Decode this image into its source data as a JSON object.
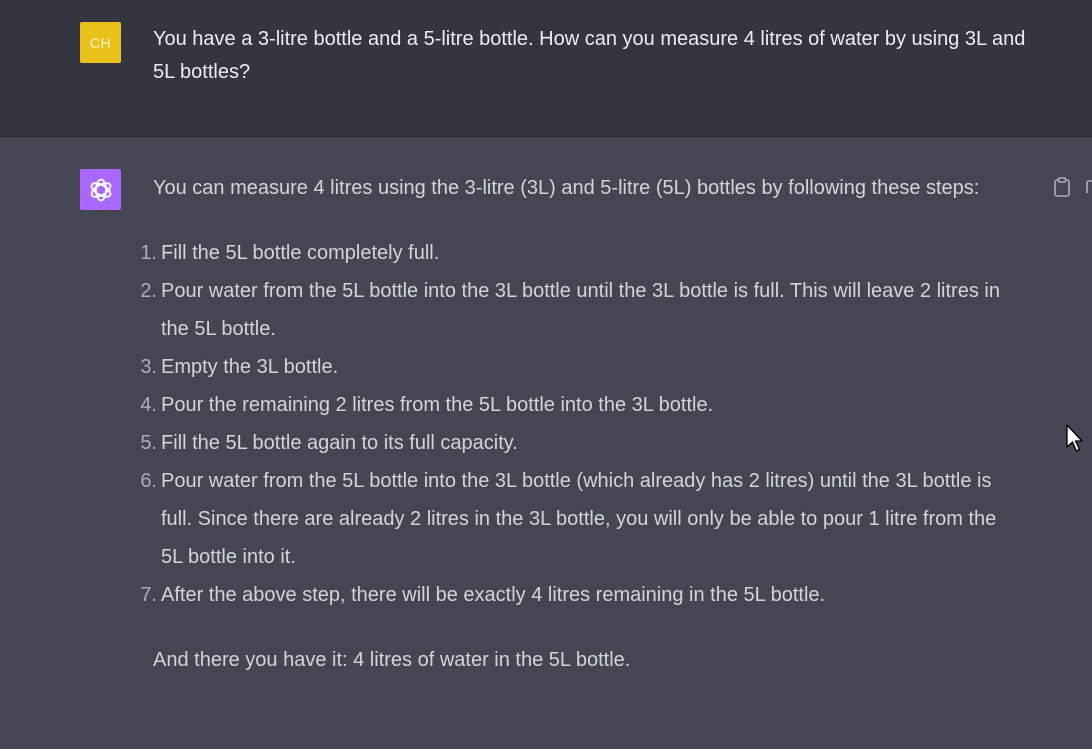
{
  "user_message": {
    "avatar_initials": "CH",
    "avatar_color": "#e8c21a",
    "text": "You have a 3-litre bottle and a 5-litre bottle. How can you measure 4 litres of water by using 3L and 5L bottles?"
  },
  "assistant_message": {
    "avatar_color": "#ab68ff",
    "avatar_icon": "openai-logo-icon",
    "intro": "You can measure 4 litres using the 3-litre (3L) and 5-litre (5L) bottles by following these steps:",
    "steps": [
      {
        "num": "1.",
        "text": "Fill the 5L bottle completely full."
      },
      {
        "num": "2.",
        "text": "Pour water from the 5L bottle into the 3L bottle until the 3L bottle is full. This will leave 2 litres in the 5L bottle."
      },
      {
        "num": "3.",
        "text": "Empty the 3L bottle."
      },
      {
        "num": "4.",
        "text": "Pour the remaining 2 litres from the 5L bottle into the 3L bottle."
      },
      {
        "num": "5.",
        "text": "Fill the 5L bottle again to its full capacity."
      },
      {
        "num": "6.",
        "text": "Pour water from the 5L bottle into the 3L bottle (which already has 2 litres) until the 3L bottle is full. Since there are already 2 litres in the 3L bottle, you will only be able to pour 1 litre from the 5L bottle into it."
      },
      {
        "num": "7.",
        "text": "After the above step, there will be exactly 4 litres remaining in the 5L bottle."
      }
    ],
    "outro": "And there you have it: 4 litres of water in the 5L bottle."
  },
  "icons": {
    "copy": "clipboard-icon",
    "cursor": "mouse-cursor-icon"
  },
  "colors": {
    "user_bg": "#343541",
    "assistant_bg": "#444654",
    "text": "#d1d5db"
  }
}
